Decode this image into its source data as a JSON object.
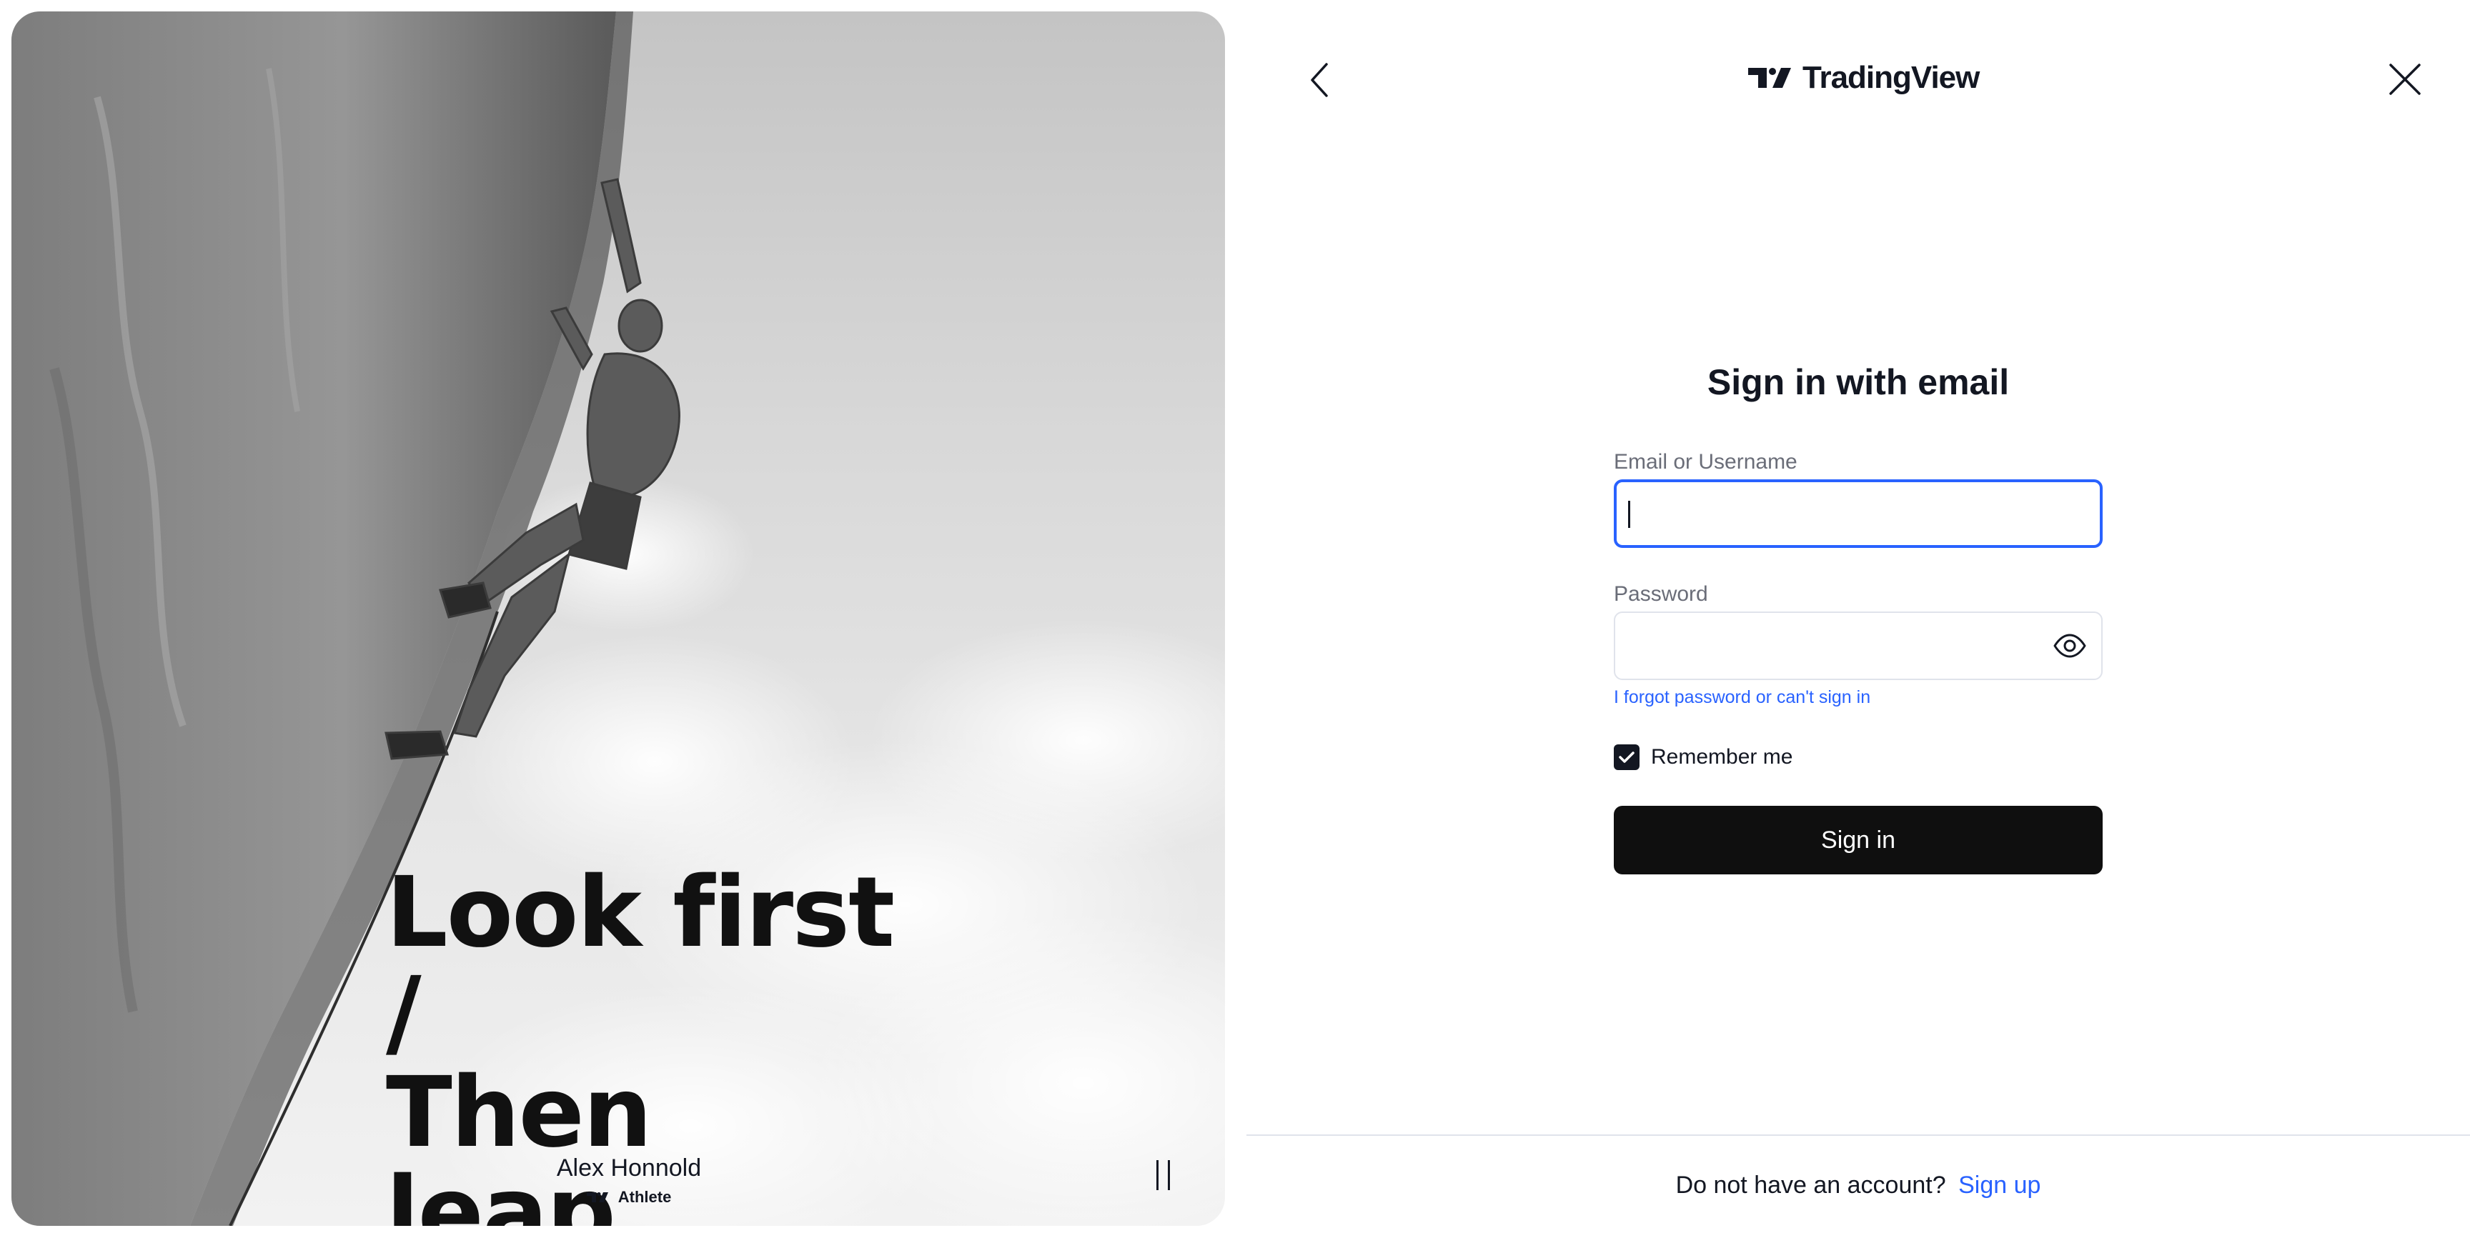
{
  "hero": {
    "tagline_line1": "Look first /",
    "tagline_line2": "Then leap.",
    "athlete_name": "Alex Honnold",
    "athlete_badge": "Athlete",
    "pause_icon": "pause-icon"
  },
  "header": {
    "brand_name": "TradingView",
    "back_icon": "chevron-left-icon",
    "close_icon": "close-icon"
  },
  "form": {
    "title": "Sign in with email",
    "email_label": "Email or Username",
    "email_value": "",
    "password_label": "Password",
    "password_value": "",
    "password_toggle_icon": "eye-icon",
    "forgot_link": "I forgot password or can't sign in",
    "remember_label": "Remember me",
    "remember_checked": true,
    "submit_label": "Sign in"
  },
  "footer": {
    "prompt": "Do not have an account?",
    "signup_link": "Sign up"
  },
  "colors": {
    "accent": "#2962ff",
    "button_bg": "#0f0f0f",
    "text": "#131722",
    "muted": "#6a6d78",
    "border": "#e0e3eb"
  }
}
